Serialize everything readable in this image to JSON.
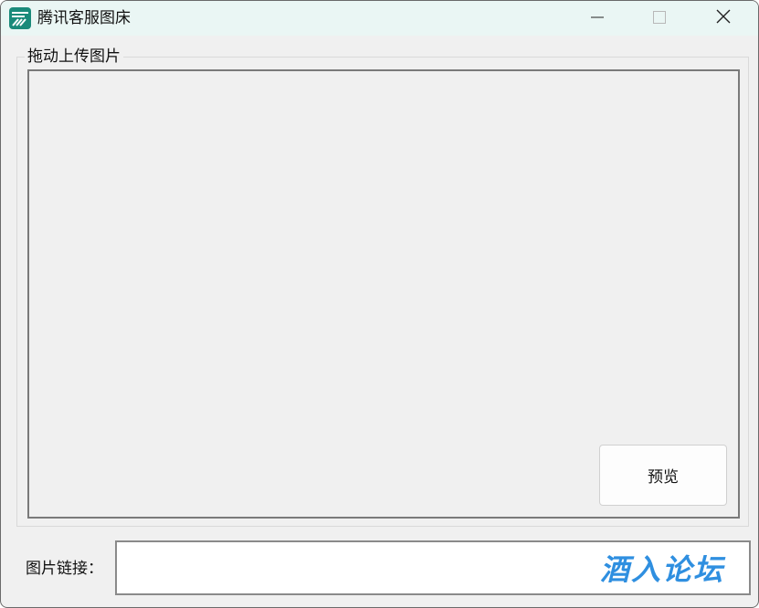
{
  "window": {
    "title": "腾讯客服图床",
    "app_icon": "image-host-icon",
    "controls": {
      "minimize": "minimize-icon",
      "maximize": "maximize-icon",
      "close": "close-icon"
    }
  },
  "upload_group": {
    "legend": "拖动上传图片",
    "preview_button_label": "预览"
  },
  "link_row": {
    "label": "图片链接：",
    "value": ""
  },
  "watermark": {
    "text": "酒入论坛",
    "color": "#2f8fe0"
  },
  "colors": {
    "titlebar": "#eaf6f4",
    "window_bg": "#f0f0f0",
    "accent_icon": "#1a8a7a"
  }
}
